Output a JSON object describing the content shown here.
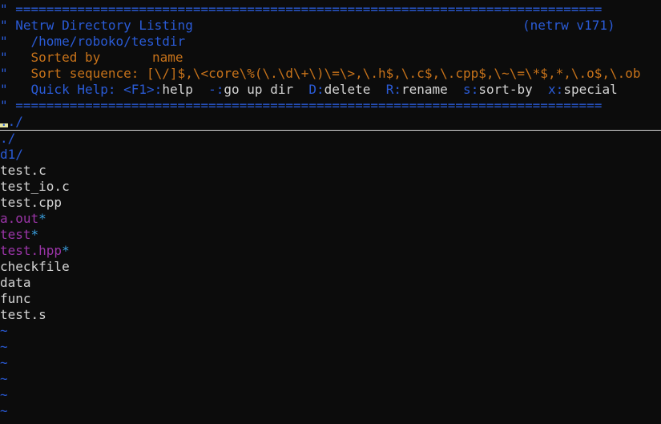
{
  "banner": {
    "separator": "\" ============================================================================",
    "title_prefix": "\" ",
    "title": "Netrw Directory Listing",
    "version": "(netrw v171)",
    "path_prefix": "\"   ",
    "path": "/home/roboko/testdir",
    "sorted_prefix": "\"   ",
    "sorted_label": "Sorted by",
    "sorted_value": "name",
    "sequence_prefix": "\"   ",
    "sequence_label": "Sort sequence:",
    "sequence_value": "[\\/]$,\\<core\\%(\\.\\d\\+\\)\\=\\>,\\.h$,\\.c$,\\.cpp$,\\~\\=\\*$,*,\\.o$,\\.ob",
    "help_prefix": "\"   ",
    "help_label": "Quick Help:",
    "help_items": [
      {
        "key": "<F1>",
        "sep": ":",
        "action": "help"
      },
      {
        "key": "-",
        "sep": ":",
        "action": "go up dir"
      },
      {
        "key": "D",
        "sep": ":",
        "action": "delete"
      },
      {
        "key": "R",
        "sep": ":",
        "action": "rename"
      },
      {
        "key": "s",
        "sep": ":",
        "action": "sort-by"
      },
      {
        "key": "x",
        "sep": ":",
        "action": "special"
      }
    ]
  },
  "entries": {
    "parent": "../",
    "current": "./",
    "d1": "d1/",
    "test_c": "test.c",
    "test_io_c": "test_io.c",
    "test_cpp": "test.cpp",
    "a_out": "a.out",
    "test": "test",
    "test_hpp": "test.hpp",
    "checkfile": "checkfile",
    "data": "data",
    "func": "func",
    "test_s": "test.s",
    "exec_marker": "*"
  },
  "tilde": "~",
  "colors": {
    "background": "#0c0c0c",
    "comment_blue": "#2a5bd7",
    "orange": "#c8731a",
    "purple": "#9b35a8",
    "cyan": "#3aa0e0",
    "text": "#d4d4d4"
  }
}
